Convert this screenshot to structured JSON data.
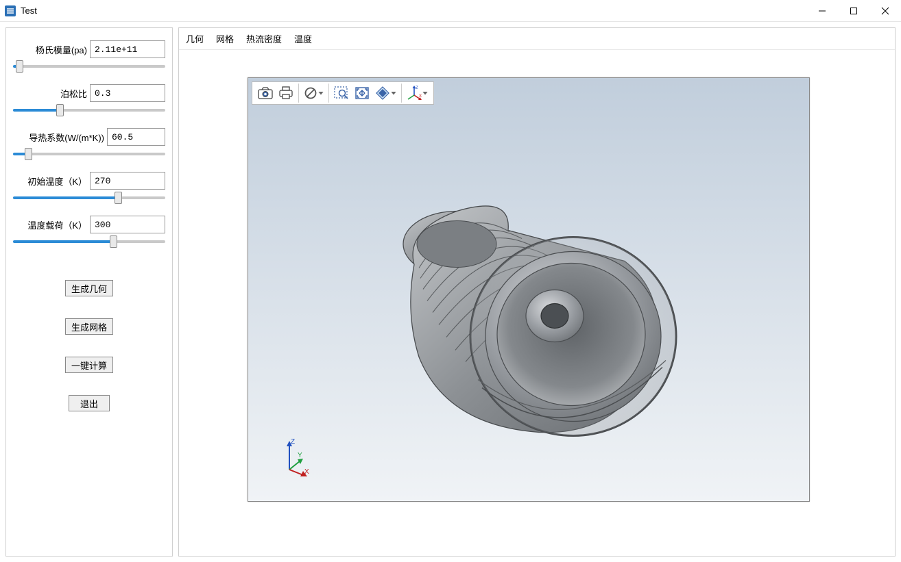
{
  "window": {
    "title": "Test"
  },
  "sidebar": {
    "params": [
      {
        "label": "杨氏模量(pa)",
        "value": "2.11e+11",
        "slider_pct": 2
      },
      {
        "label": "泊松比",
        "value": "0.3",
        "slider_pct": 30
      },
      {
        "label": "导热系数(W/(m*K))",
        "value": "60.5",
        "slider_pct": 8
      },
      {
        "label": "初始温度（K）",
        "value": "270",
        "slider_pct": 70
      },
      {
        "label": "温度载荷（K）",
        "value": "300",
        "slider_pct": 67
      }
    ],
    "buttons": {
      "generate_geometry": "生成几何",
      "generate_mesh": "生成网格",
      "one_click_compute": "一键计算",
      "exit": "退出"
    }
  },
  "tabs": {
    "geometry": "几何",
    "mesh": "网格",
    "heat_flux": "热流密度",
    "temperature": "温度"
  },
  "toolbar_icons": {
    "screenshot": "camera-icon",
    "print": "print-icon",
    "forbid": "forbid-icon",
    "zoom_area": "zoom-area-icon",
    "fit_view": "fit-view-icon",
    "rotate_highlight": "rotate-icon",
    "axes": "axes-icon"
  },
  "axis_labels": {
    "x": "X",
    "y": "Y",
    "z": "Z"
  },
  "colors": {
    "viewport_top": "#c1cedc",
    "viewport_bottom": "#f0f3f6",
    "slider_active": "#2b8bd6"
  }
}
